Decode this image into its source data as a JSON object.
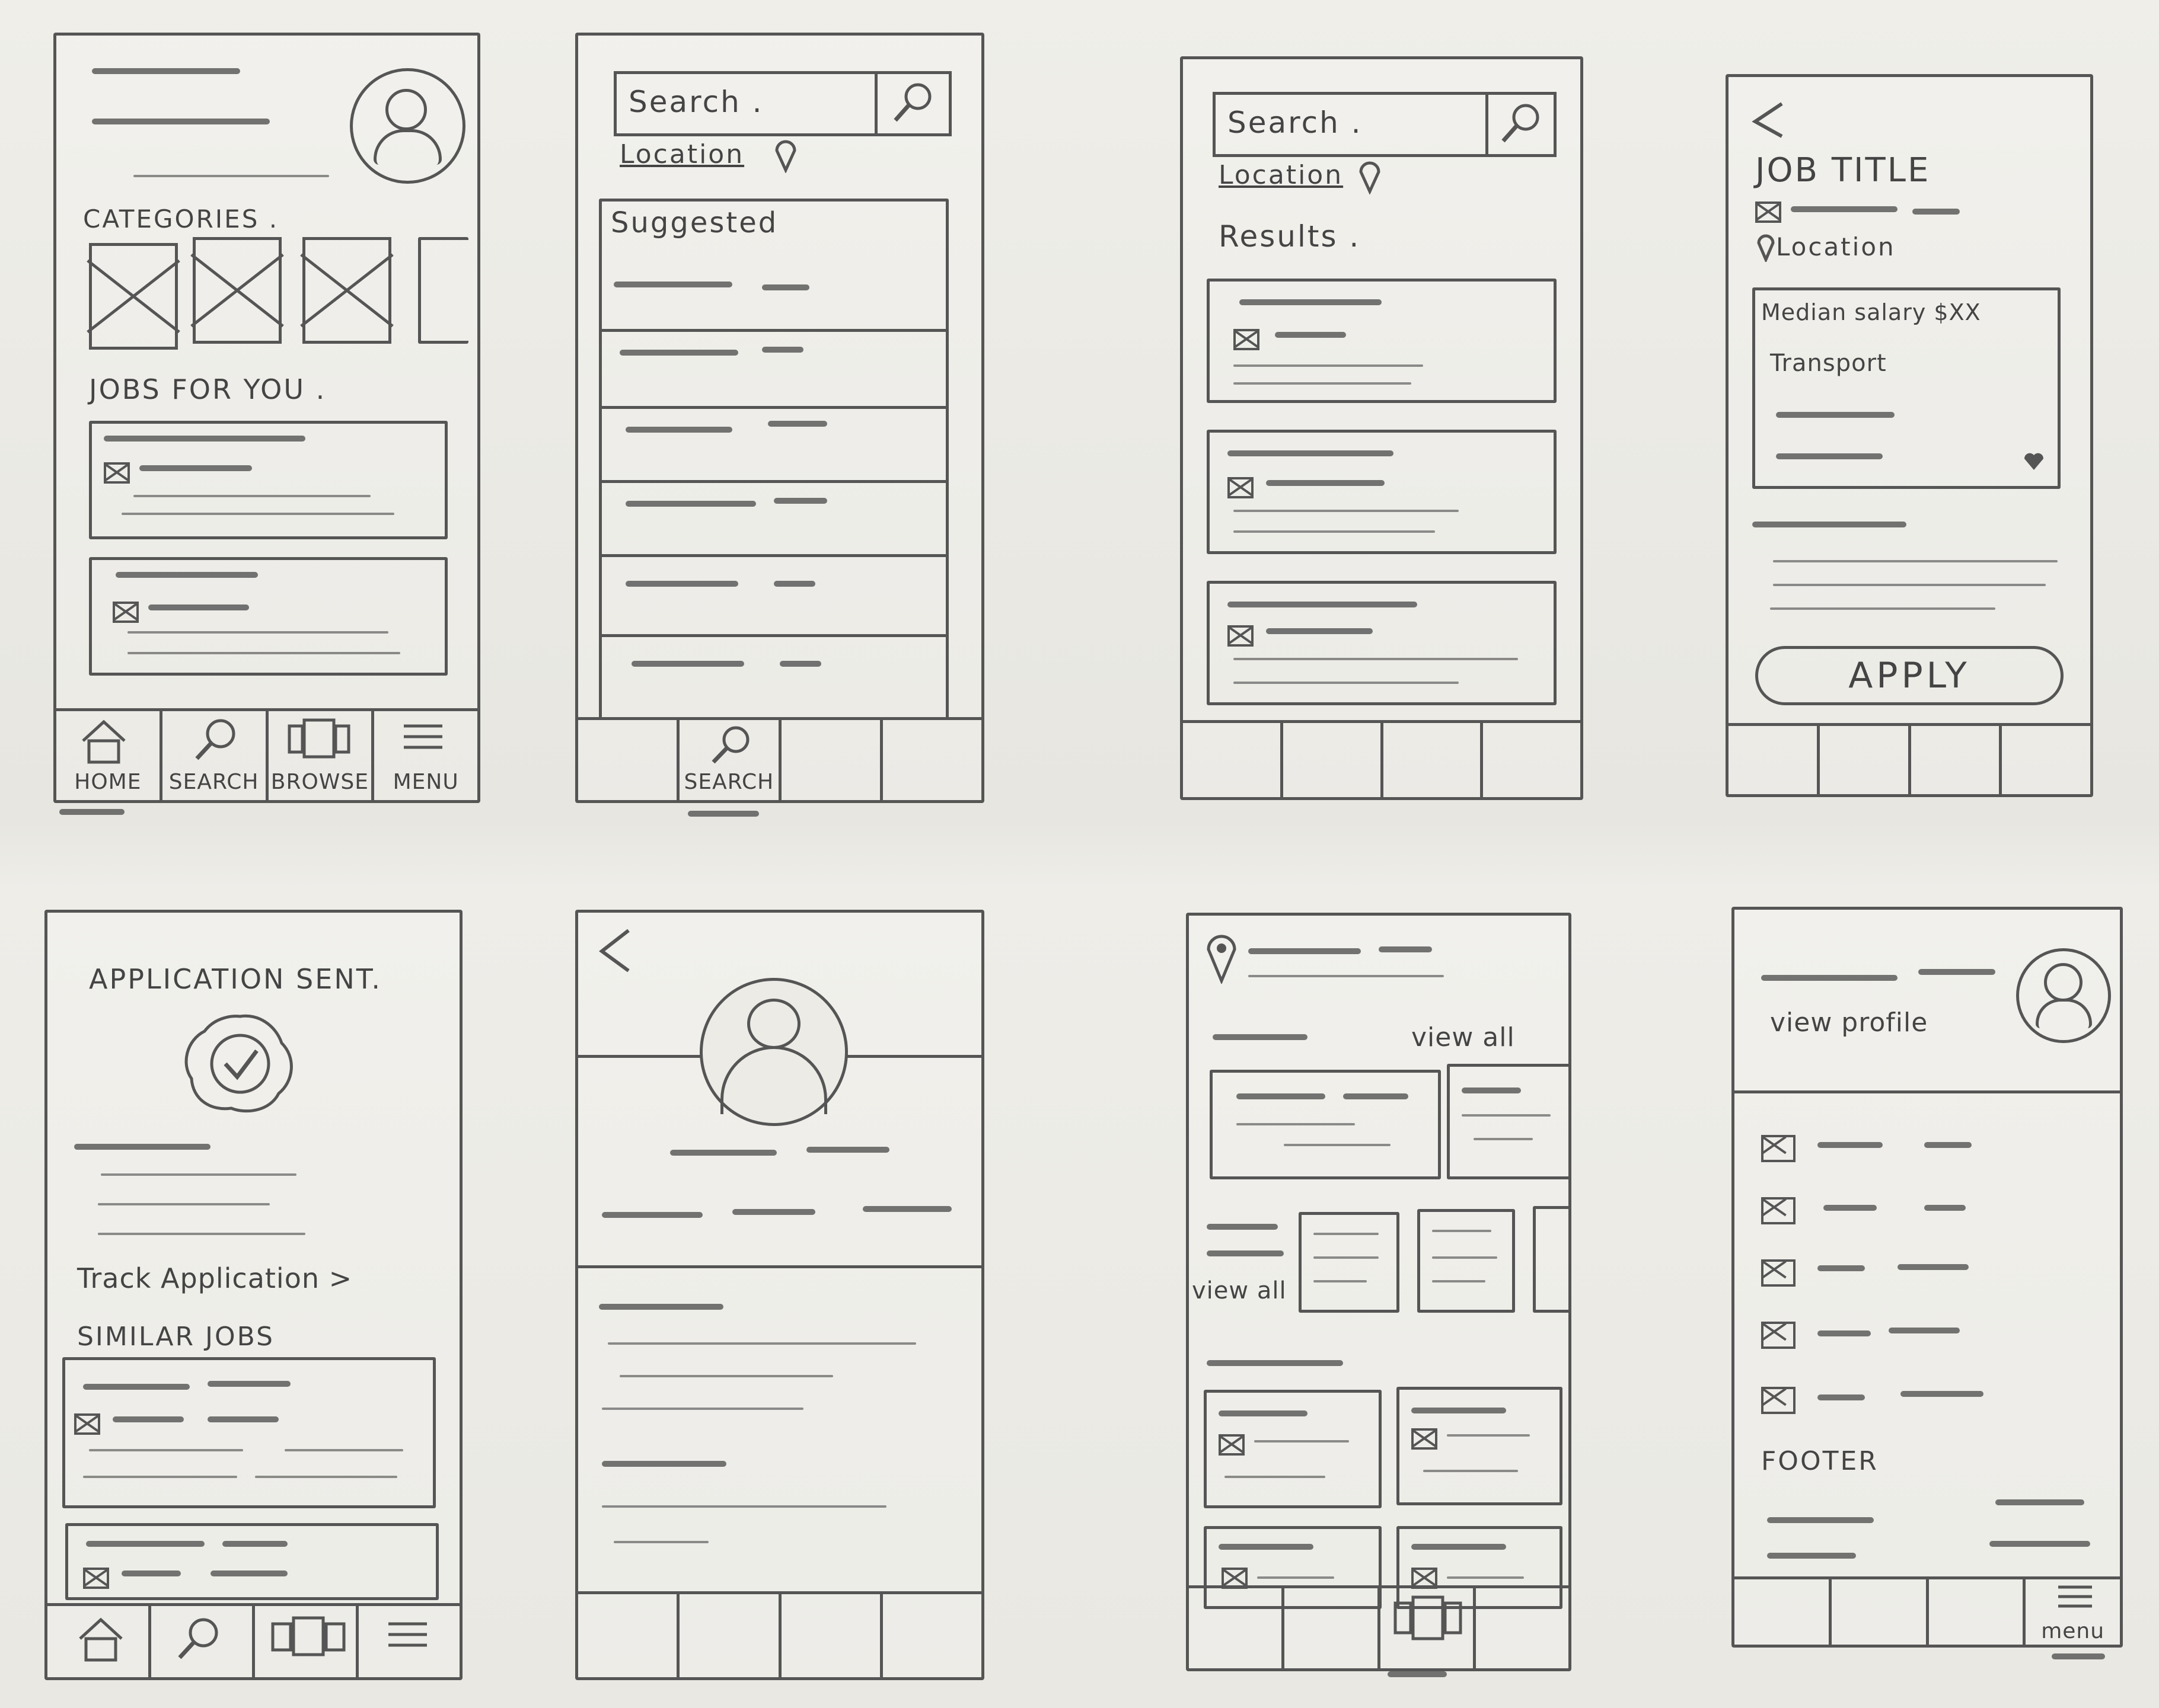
{
  "home": {
    "categories_label": "CATEGORIES .",
    "jobs_label": "JOBS FOR YOU .",
    "nav": [
      "HOME",
      "SEARCH",
      "BROWSE",
      "MENU"
    ]
  },
  "search_screen": {
    "search_placeholder": "Search .",
    "location_label": "Location",
    "suggested_label": "Suggested",
    "nav_label": "SEARCH"
  },
  "results_screen": {
    "search_placeholder": "Search .",
    "location_label": "Location",
    "results_label": "Results ."
  },
  "job_screen": {
    "title": "JOB TITLE",
    "location_label": "Location",
    "salary_text": "Median salary $XX",
    "transport_text": "Transport",
    "apply_label": "APPLY"
  },
  "application_screen": {
    "title": "APPLICATION SENT.",
    "track_link": "Track Application >",
    "similar_label": "SIMILAR JOBS"
  },
  "browse_screen": {
    "view_all_1": "view all",
    "view_all_2": "view all"
  },
  "menu_screen": {
    "view_profile": "view profile",
    "footer_label": "FOOTER",
    "nav_label": "menu"
  }
}
